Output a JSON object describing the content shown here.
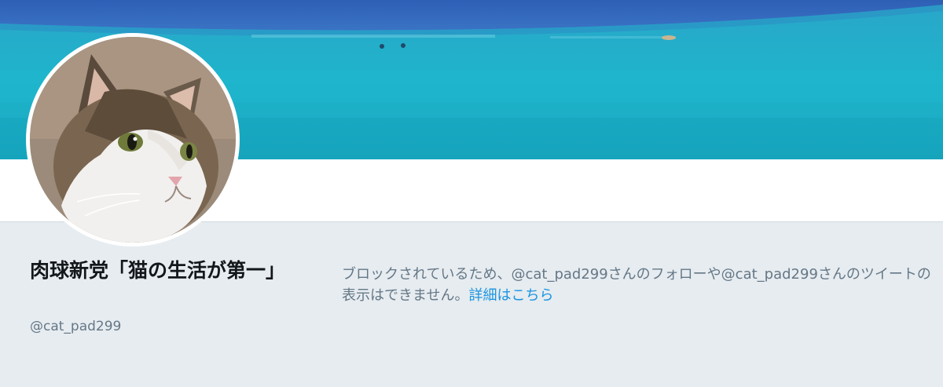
{
  "profile": {
    "display_name": "肉球新党「猫の生活が第一」",
    "handle": "@cat_pad299"
  },
  "blocked_notice": {
    "message": "ブロックされているため、@cat_pad299さんのフォローや@cat_pad299さんのツイートの表示はできません。",
    "link_label": "詳細はこちら"
  },
  "colors": {
    "background": "#e6ecf0",
    "link": "#1b95e0",
    "secondary_text": "#657786",
    "primary_text": "#14171a"
  },
  "images": {
    "banner": "ocean-banner-image",
    "avatar": "cat-avatar-image"
  }
}
